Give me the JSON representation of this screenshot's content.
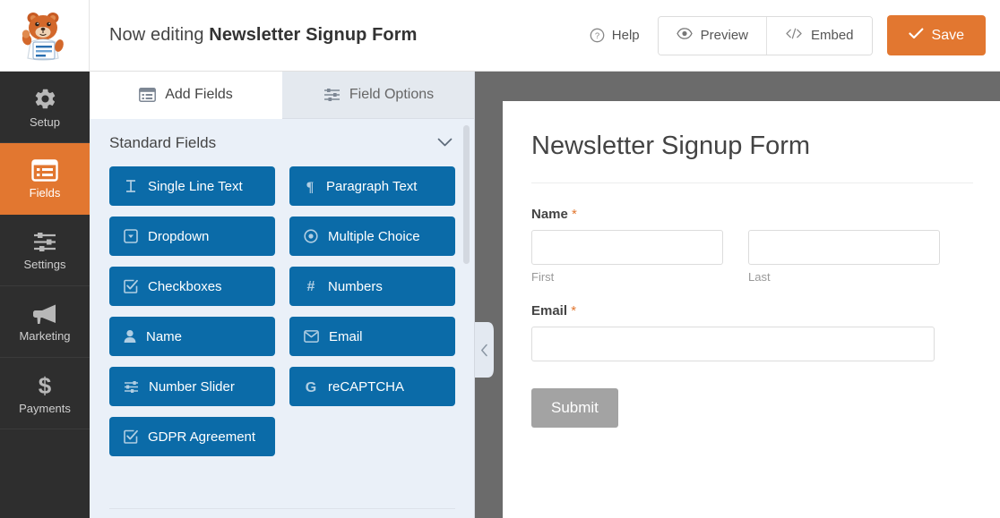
{
  "header": {
    "logo_name": "wpforms-mascot-logo",
    "editing_prefix": "Now editing",
    "form_name": "Newsletter Signup Form",
    "help_label": "Help",
    "preview_label": "Preview",
    "embed_label": "Embed",
    "save_label": "Save",
    "save_color": "#e27730"
  },
  "sidebar": {
    "items": [
      {
        "label": "Setup",
        "icon": "gear-icon",
        "active": false
      },
      {
        "label": "Fields",
        "icon": "list-icon",
        "active": true
      },
      {
        "label": "Settings",
        "icon": "sliders-icon",
        "active": false
      },
      {
        "label": "Marketing",
        "icon": "megaphone-icon",
        "active": false
      },
      {
        "label": "Payments",
        "icon": "dollar-icon",
        "active": false
      }
    ],
    "active_color": "#e27730",
    "background_color": "#2e2e2e"
  },
  "panel": {
    "tabs": [
      {
        "label": "Add Fields",
        "icon": "add-fields-icon",
        "active": true
      },
      {
        "label": "Field Options",
        "icon": "field-options-icon",
        "active": false
      }
    ],
    "section_title": "Standard Fields",
    "section_collapsed": false,
    "field_button_color": "#0b6ba8",
    "fields": [
      {
        "label": "Single Line Text",
        "icon": "text-cursor-icon"
      },
      {
        "label": "Paragraph Text",
        "icon": "pilcrow-icon"
      },
      {
        "label": "Dropdown",
        "icon": "dropdown-icon"
      },
      {
        "label": "Multiple Choice",
        "icon": "radio-icon"
      },
      {
        "label": "Checkboxes",
        "icon": "checkbox-icon"
      },
      {
        "label": "Numbers",
        "icon": "hash-icon"
      },
      {
        "label": "Name",
        "icon": "user-icon"
      },
      {
        "label": "Email",
        "icon": "envelope-icon"
      },
      {
        "label": "Number Slider",
        "icon": "sliders-icon"
      },
      {
        "label": "reCAPTCHA",
        "icon": "google-g-icon"
      },
      {
        "label": "GDPR Agreement",
        "icon": "checkbox-icon"
      }
    ]
  },
  "preview": {
    "form_title": "Newsletter Signup Form",
    "required_marker": "*",
    "fields": [
      {
        "label": "Name",
        "required": true,
        "type": "name",
        "subfields": [
          {
            "value": "",
            "sublabel": "First"
          },
          {
            "value": "",
            "sublabel": "Last"
          }
        ]
      },
      {
        "label": "Email",
        "required": true,
        "type": "email",
        "value": ""
      }
    ],
    "submit_label": "Submit",
    "submit_color": "#a3a3a3",
    "background_color": "#6b6b6b"
  },
  "collapse_handle": {
    "icon": "chevron-left-icon"
  }
}
